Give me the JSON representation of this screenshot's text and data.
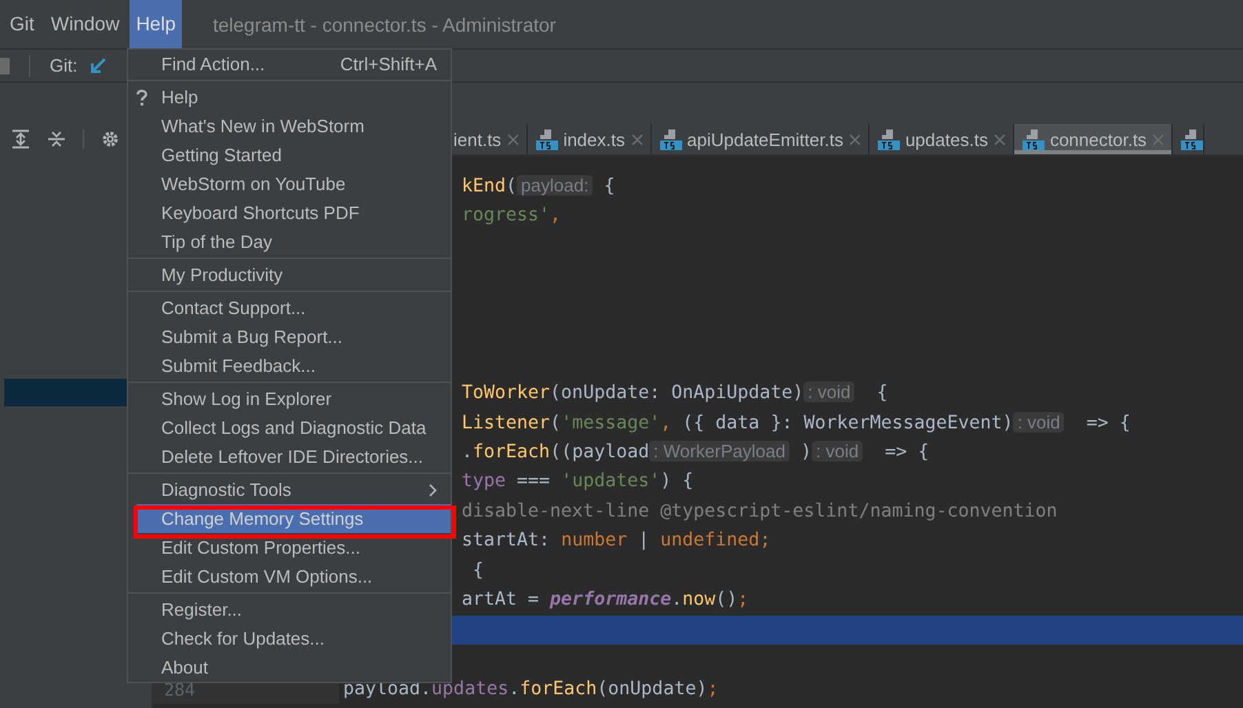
{
  "menubar": {
    "items": [
      {
        "label": "Git",
        "selected": false
      },
      {
        "label": "Window",
        "selected": false
      },
      {
        "label": "Help",
        "selected": true
      }
    ],
    "title": "telegram-tt - connector.ts - Administrator"
  },
  "toolbar": {
    "label": "Git:"
  },
  "editor": {
    "tabs": [
      {
        "kind": "clipped",
        "label": "ient.ts",
        "selected": false
      },
      {
        "kind": "file",
        "label": "index.ts",
        "selected": false
      },
      {
        "kind": "file",
        "label": "apiUpdateEmitter.ts",
        "selected": false
      },
      {
        "kind": "file",
        "label": "updates.ts",
        "selected": false
      },
      {
        "kind": "file",
        "label": "connector.ts",
        "selected": true
      },
      {
        "kind": "icon_only",
        "selected": false
      }
    ],
    "lines": [
      {
        "kind": "clipped",
        "current": false,
        "tokens": [
          {
            "kind": "fn",
            "text": "kEnd"
          },
          {
            "kind": "plain",
            "text": "("
          },
          {
            "kind": "hint",
            "text": "payload:"
          },
          {
            "kind": "plain",
            "text": " {"
          }
        ]
      },
      {
        "kind": "clipped",
        "current": false,
        "tokens": [
          {
            "kind": "string",
            "text": "rogress'"
          },
          {
            "kind": "keyword",
            "text": ","
          }
        ]
      },
      {
        "kind": "clipped",
        "current": false
      },
      {
        "kind": "clipped",
        "current": false
      },
      {
        "kind": "clipped",
        "current": false
      },
      {
        "kind": "clipped",
        "current": false
      },
      {
        "kind": "clipped",
        "current": false
      },
      {
        "kind": "clipped",
        "current": false,
        "tokens": [
          {
            "kind": "fn",
            "text": "ToWorker"
          },
          {
            "kind": "plain",
            "text": "(onUpdate: OnApiUpdate)"
          },
          {
            "kind": "hint",
            "text": ": void"
          },
          {
            "kind": "plain",
            "text": "  {"
          }
        ]
      },
      {
        "kind": "clipped",
        "current": false,
        "tokens": [
          {
            "kind": "fn",
            "text": "Listener"
          },
          {
            "kind": "plain",
            "text": "("
          },
          {
            "kind": "string",
            "text": "'message'"
          },
          {
            "kind": "keyword",
            "text": ","
          },
          {
            "kind": "plain",
            "text": " ({ data }: WorkerMessageEvent)"
          },
          {
            "kind": "hint",
            "text": ": void"
          },
          {
            "kind": "plain",
            "text": "  => {"
          }
        ]
      },
      {
        "kind": "clipped",
        "current": false,
        "tokens": [
          {
            "kind": "plain",
            "text": "."
          },
          {
            "kind": "fn",
            "text": "forEach"
          },
          {
            "kind": "plain",
            "text": "((payload"
          },
          {
            "kind": "hint",
            "text": ": WorkerPayload"
          },
          {
            "kind": "plain",
            "text": " )"
          },
          {
            "kind": "hint",
            "text": ": void"
          },
          {
            "kind": "plain",
            "text": "  => {"
          }
        ]
      },
      {
        "kind": "clipped",
        "current": false,
        "tokens": [
          {
            "kind": "field",
            "text": "type"
          },
          {
            "kind": "plain",
            "text": " === "
          },
          {
            "kind": "string",
            "text": "'updates'"
          },
          {
            "kind": "plain",
            "text": ") {"
          }
        ]
      },
      {
        "kind": "clipped",
        "current": false,
        "tokens": [
          {
            "kind": "comment",
            "text": "disable-next-line @typescript-eslint/naming-convention"
          }
        ]
      },
      {
        "kind": "clipped",
        "current": false,
        "tokens": [
          {
            "kind": "plain",
            "text": "startAt: "
          },
          {
            "kind": "keyword",
            "text": "number"
          },
          {
            "kind": "plain",
            "text": " | "
          },
          {
            "kind": "keyword",
            "text": "undefined"
          },
          {
            "kind": "keyword",
            "text": ";"
          }
        ]
      },
      {
        "kind": "clipped",
        "current": false,
        "tokens": [
          {
            "kind": "plain",
            "text": " {"
          }
        ]
      },
      {
        "kind": "clipped",
        "current": false,
        "tokens": [
          {
            "kind": "plain",
            "text": "artAt = "
          },
          {
            "kind": "italic",
            "text": "performance"
          },
          {
            "kind": "plain",
            "text": "."
          },
          {
            "kind": "fn",
            "text": "now"
          },
          {
            "kind": "plain",
            "text": "()"
          },
          {
            "kind": "keyword",
            "text": ";"
          }
        ]
      },
      {
        "kind": "clipped",
        "current": true
      },
      {
        "kind": "clipped",
        "current": false
      },
      {
        "kind": "full",
        "current": false,
        "number": "284",
        "tokens": [
          {
            "kind": "plain",
            "text": "payload."
          },
          {
            "kind": "field",
            "text": "updates"
          },
          {
            "kind": "plain",
            "text": "."
          },
          {
            "kind": "fn",
            "text": "forEach"
          },
          {
            "kind": "plain",
            "text": "(onUpdate)"
          },
          {
            "kind": "keyword",
            "text": ";"
          }
        ]
      }
    ]
  },
  "menu": {
    "groups": [
      [
        {
          "kind": "action",
          "label": "Find Action...",
          "shortcut": "Ctrl+Shift+A",
          "selected": false,
          "annotated": false
        }
      ],
      [
        {
          "kind": "help",
          "label": "Help",
          "selected": false,
          "annotated": false
        },
        {
          "kind": "action",
          "label": "What's New in WebStorm",
          "selected": false,
          "annotated": false
        },
        {
          "kind": "action",
          "label": "Getting Started",
          "selected": false,
          "annotated": false
        },
        {
          "kind": "action",
          "label": "WebStorm on YouTube",
          "selected": false,
          "annotated": false
        },
        {
          "kind": "action",
          "label": "Keyboard Shortcuts PDF",
          "selected": false,
          "annotated": false
        },
        {
          "kind": "action",
          "label": "Tip of the Day",
          "selected": false,
          "annotated": false
        }
      ],
      [
        {
          "kind": "action",
          "label": "My Productivity",
          "selected": false,
          "annotated": false
        }
      ],
      [
        {
          "kind": "action",
          "label": "Contact Support...",
          "selected": false,
          "annotated": false
        },
        {
          "kind": "action",
          "label": "Submit a Bug Report...",
          "selected": false,
          "annotated": false
        },
        {
          "kind": "action",
          "label": "Submit Feedback...",
          "selected": false,
          "annotated": false
        }
      ],
      [
        {
          "kind": "action",
          "label": "Show Log in Explorer",
          "selected": false,
          "annotated": false
        },
        {
          "kind": "action",
          "label": "Collect Logs and Diagnostic Data",
          "selected": false,
          "annotated": false
        },
        {
          "kind": "action",
          "label": "Delete Leftover IDE Directories...",
          "selected": false,
          "annotated": false
        }
      ],
      [
        {
          "kind": "submenu",
          "label": "Diagnostic Tools",
          "selected": false,
          "annotated": false
        },
        {
          "kind": "action",
          "label": "Change Memory Settings",
          "selected": true,
          "annotated": true
        },
        {
          "kind": "action",
          "label": "Edit Custom Properties...",
          "selected": false,
          "annotated": false
        },
        {
          "kind": "action",
          "label": "Edit Custom VM Options...",
          "selected": false,
          "annotated": false
        }
      ],
      [
        {
          "kind": "action",
          "label": "Register...",
          "selected": false,
          "annotated": false
        },
        {
          "kind": "action",
          "label": "Check for Updates...",
          "selected": false,
          "annotated": false
        },
        {
          "kind": "action",
          "label": "About",
          "selected": false,
          "annotated": false
        }
      ]
    ]
  }
}
